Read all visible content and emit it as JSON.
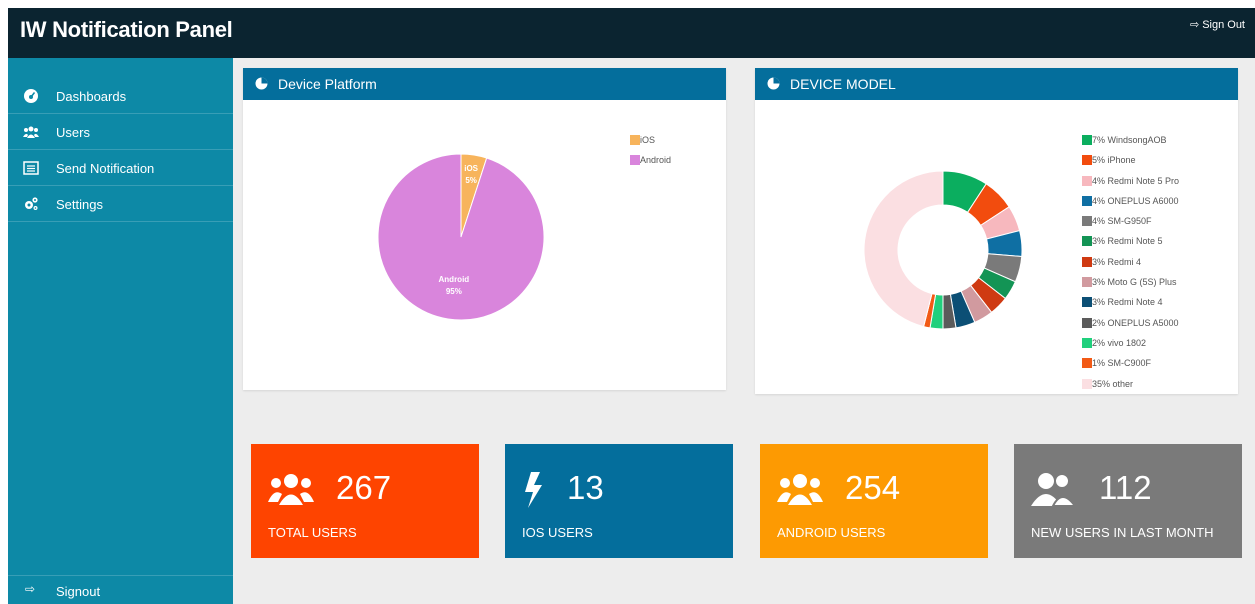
{
  "header": {
    "title": "IW Notification Panel",
    "signout_label": "Sign Out"
  },
  "sidebar": {
    "items": [
      {
        "label": "Dashboards",
        "icon": "dashboard-icon"
      },
      {
        "label": "Users",
        "icon": "users-icon"
      },
      {
        "label": "Send Notification",
        "icon": "list-icon"
      },
      {
        "label": "Settings",
        "icon": "gears-icon"
      }
    ],
    "signout_label": "Signout"
  },
  "platform_panel": {
    "title": "Device Platform",
    "legend": [
      {
        "label": "iOS",
        "color": "#f7b45c"
      },
      {
        "label": "Android",
        "color": "#d985dc"
      }
    ],
    "slice_labels": [
      {
        "name": "iOS",
        "pct": "5%"
      },
      {
        "name": "Android",
        "pct": "95%"
      }
    ]
  },
  "model_panel": {
    "title": "DEVICE MODEL",
    "legend": [
      {
        "label": "7% WindsongAOB",
        "color": "#0bae5f"
      },
      {
        "label": "5% iPhone",
        "color": "#f24c0e"
      },
      {
        "label": "4% Redmi Note 5 Pro",
        "color": "#f7b8be"
      },
      {
        "label": "4% ONEPLUS A6000",
        "color": "#0f6fa3"
      },
      {
        "label": "4% SM-G950F",
        "color": "#7a7a7a"
      },
      {
        "label": "3% Redmi Note 5",
        "color": "#139455"
      },
      {
        "label": "3% Redmi 4",
        "color": "#cf3a12"
      },
      {
        "label": "3% Moto G (5S) Plus",
        "color": "#d19a9f"
      },
      {
        "label": "3% Redmi Note 4",
        "color": "#0c4f75"
      },
      {
        "label": "2% ONEPLUS A5000",
        "color": "#5b5b5b"
      },
      {
        "label": "2% vivo 1802",
        "color": "#21d07d"
      },
      {
        "label": "1% SM-C900F",
        "color": "#f25a16"
      },
      {
        "label": "35% other",
        "color": "#fbdfe2"
      }
    ]
  },
  "chart_data": [
    {
      "type": "pie",
      "title": "Device Platform",
      "categories": [
        "iOS",
        "Android"
      ],
      "values": [
        5,
        95
      ],
      "colors": [
        "#f7b45c",
        "#d985dc"
      ],
      "legend": "top-right"
    },
    {
      "type": "pie",
      "title": "DEVICE MODEL",
      "categories": [
        "WindsongAOB",
        "iPhone",
        "Redmi Note 5 Pro",
        "ONEPLUS A6000",
        "SM-G950F",
        "Redmi Note 5",
        "Redmi 4",
        "Moto G (5S) Plus",
        "Redmi Note 4",
        "ONEPLUS A5000",
        "vivo 1802",
        "SM-C900F",
        "other"
      ],
      "values": [
        7,
        5,
        4,
        4,
        4,
        3,
        3,
        3,
        3,
        2,
        2,
        1,
        35
      ],
      "colors": [
        "#0bae5f",
        "#f24c0e",
        "#f7b8be",
        "#0f6fa3",
        "#7a7a7a",
        "#139455",
        "#cf3a12",
        "#d19a9f",
        "#0c4f75",
        "#5b5b5b",
        "#21d07d",
        "#f25a16",
        "#fbdfe2"
      ],
      "legend": "right"
    }
  ],
  "stats": [
    {
      "value": "267",
      "label": "TOTAL USERS",
      "icon": "users-icon",
      "color": "#fe4400"
    },
    {
      "value": "13",
      "label": "IOS USERS",
      "icon": "bolt-icon",
      "color": "#046e9c"
    },
    {
      "value": "254",
      "label": "ANDROID USERS",
      "icon": "users-icon",
      "color": "#fd9a02"
    },
    {
      "value": "112",
      "label": "NEW USERS IN LAST MONTH",
      "icon": "user-pair-icon",
      "color": "#7a7a7a"
    }
  ]
}
